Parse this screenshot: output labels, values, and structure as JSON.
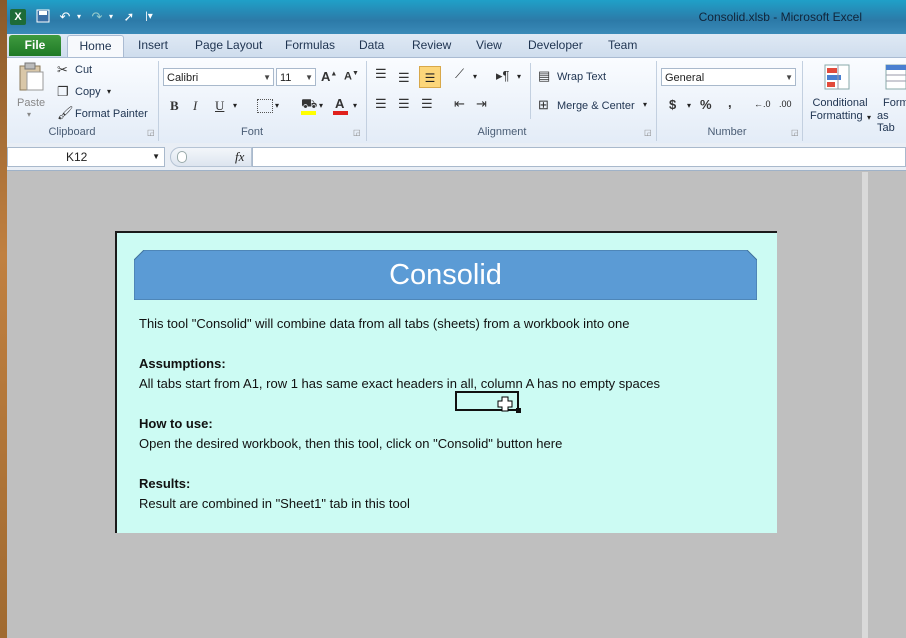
{
  "window": {
    "title": "Consolid.xlsb  -  Microsoft Excel"
  },
  "tabs": [
    "File",
    "Home",
    "Insert",
    "Page Layout",
    "Formulas",
    "Data",
    "Review",
    "View",
    "Developer",
    "Team"
  ],
  "clipboard": {
    "paste": "Paste",
    "cut": "Cut",
    "copy": "Copy",
    "format_painter": "Format Painter",
    "group": "Clipboard"
  },
  "font": {
    "name": "Calibri",
    "size": "11",
    "group": "Font",
    "bold": "B",
    "italic": "I",
    "underline": "U"
  },
  "alignment": {
    "wrap": "Wrap Text",
    "merge": "Merge & Center",
    "group": "Alignment"
  },
  "number": {
    "format": "General",
    "currency": "$",
    "percent": "%",
    "comma": ",",
    "group": "Number"
  },
  "styles": {
    "conditional": "Conditional",
    "formatting": "Formatting",
    "format_as": "Form",
    "as_table": "as Tab"
  },
  "formula_bar": {
    "name_box": "K12",
    "fx": "fx",
    "value": ""
  },
  "content": {
    "title": "Consolid",
    "intro": "This tool \"Consolid\" will combine data from all tabs (sheets) from a workbook into one",
    "assumptions_heading": "Assumptions:",
    "assumptions_text": "All tabs start from A1, row 1 has same exact headers in all, column A has no empty spaces",
    "howto_heading": "How to use:",
    "howto_text": "Open the desired workbook, then this tool, click on \"Consolid\" button here",
    "results_heading": "Results:",
    "results_text": "Result are combined in \"Sheet1\" tab in this tool"
  },
  "colors": {
    "banner": "#5b9bd5",
    "panel": "#ccfbf3",
    "sheet": "#bfbfbf"
  },
  "icons": [
    "excel-icon",
    "save-icon",
    "undo-icon",
    "redo-icon",
    "cursor-icon",
    "customize-icon",
    "scissors-icon",
    "copy-icon",
    "paintbrush-icon",
    "fill-color-icon",
    "font-color-icon",
    "border-icon",
    "fx-icon"
  ]
}
